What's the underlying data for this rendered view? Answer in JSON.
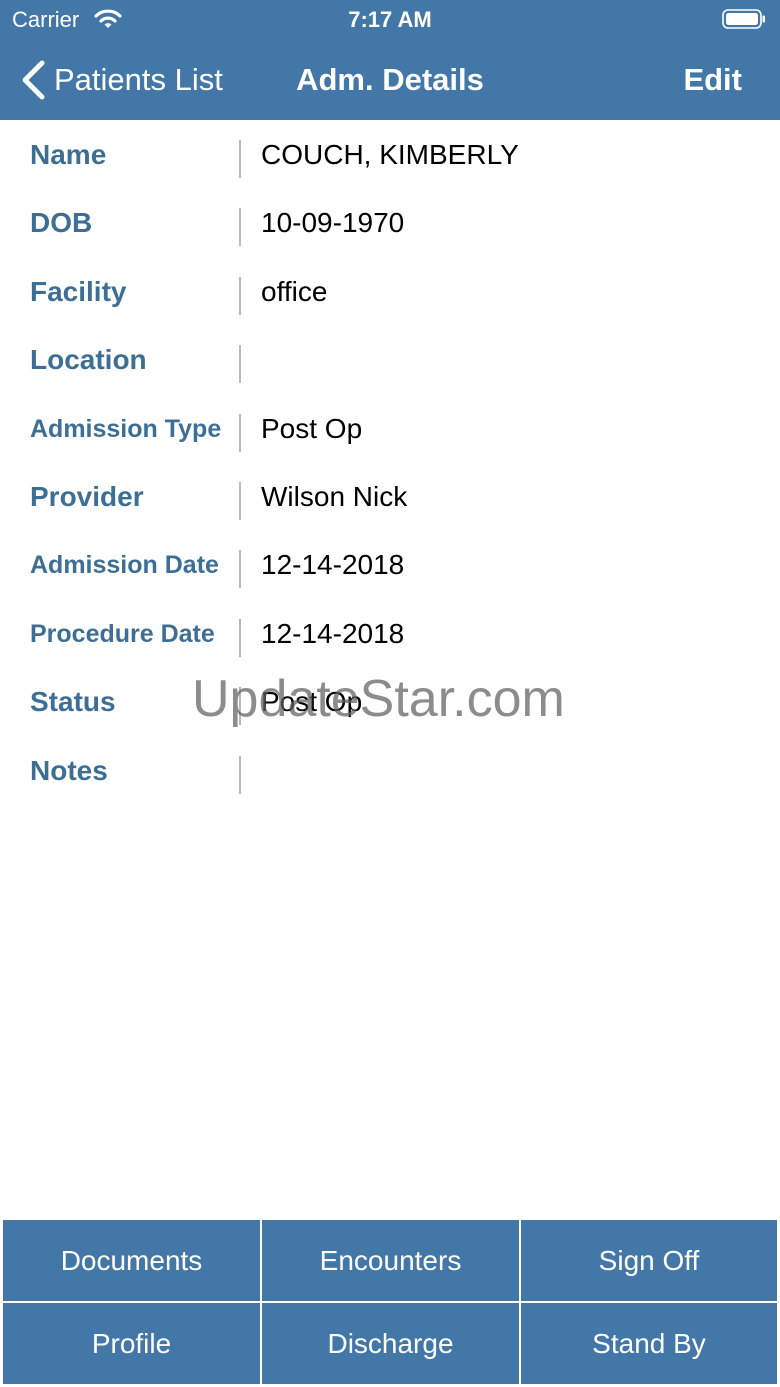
{
  "status_bar": {
    "carrier": "Carrier",
    "time": "7:17 AM",
    "wifi_icon": "wifi-icon",
    "battery_icon": "battery-icon"
  },
  "nav": {
    "back_label": "Patients List",
    "title": "Adm. Details",
    "edit_label": "Edit",
    "back_icon": "chevron-left-icon"
  },
  "details": [
    {
      "label": "Name",
      "value": "COUCH, KIMBERLY"
    },
    {
      "label": "DOB",
      "value": "10-09-1970"
    },
    {
      "label": "Facility",
      "value": "office"
    },
    {
      "label": "Location",
      "value": ""
    },
    {
      "label": "Admission Type",
      "value": "Post Op"
    },
    {
      "label": "Provider",
      "value": "Wilson Nick"
    },
    {
      "label": "Admission Date",
      "value": "12-14-2018"
    },
    {
      "label": "Procedure Date",
      "value": "12-14-2018"
    },
    {
      "label": "Status",
      "value": "Post Op"
    },
    {
      "label": "Notes",
      "value": ""
    }
  ],
  "watermark": "UpdateStar.com",
  "actions": {
    "documents": "Documents",
    "encounters": "Encounters",
    "sign_off": "Sign Off",
    "profile": "Profile",
    "discharge": "Discharge",
    "stand_by": "Stand By"
  },
  "colors": {
    "header_bg": "#4377a8",
    "label_text": "#3d6f96",
    "button_bg": "#4377a8"
  }
}
